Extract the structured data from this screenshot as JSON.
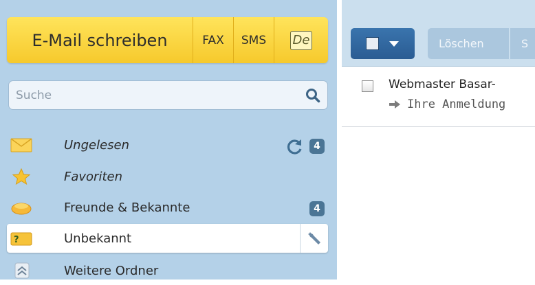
{
  "compose": {
    "email_label": "E-Mail schreiben",
    "fax_label": "FAX",
    "sms_label": "SMS",
    "de_label": "De"
  },
  "search": {
    "placeholder": "Suche",
    "icon": "search-icon"
  },
  "folders": [
    {
      "label": "Ungelesen",
      "icon": "envelope-icon",
      "italic": true,
      "badge": "4",
      "has_refresh": true
    },
    {
      "label": "Favoriten",
      "icon": "star-icon",
      "italic": true
    },
    {
      "label": "Freunde & Bekannte",
      "icon": "group-icon",
      "italic": false,
      "badge": "4"
    },
    {
      "label": "Unbekannt",
      "icon": "unknown-folder-icon",
      "italic": false,
      "selected": true,
      "action_icon": "wrench-icon"
    },
    {
      "label": "Weitere Ordner",
      "icon": "chevron-up-icon",
      "italic": false
    }
  ],
  "toolbar": {
    "delete_label": "Löschen",
    "next_label": "S"
  },
  "messages": [
    {
      "sender": "Webmaster Basar-",
      "subject": "Ihre Anmeldung"
    }
  ],
  "colors": {
    "sidebar_bg": "#b4d1e8",
    "compose_yellow": "#f6c92c",
    "badge_blue": "#4b7595",
    "select_button": "#2a5c93"
  }
}
